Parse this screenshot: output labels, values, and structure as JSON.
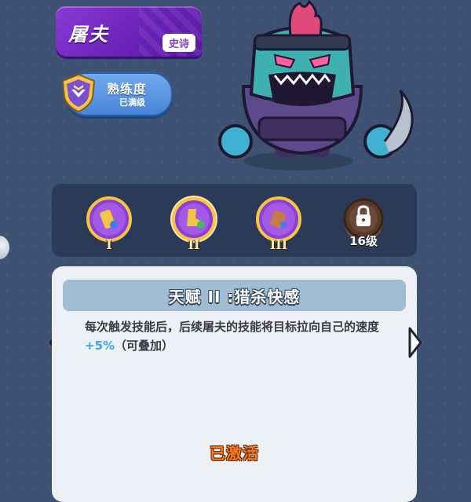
{
  "hero": {
    "name": "屠夫",
    "rarity": "史诗"
  },
  "proficiency": {
    "label": "熟练度",
    "status": "已满级"
  },
  "talents": [
    {
      "numeral": "I",
      "state": "unlocked",
      "color": "#8a3fd6"
    },
    {
      "numeral": "II",
      "state": "selected",
      "color": "#8a3fd6"
    },
    {
      "numeral": "III",
      "state": "unlocked",
      "color": "#8a3fd6"
    },
    {
      "level_label": "16级",
      "state": "locked",
      "color": "#5a3b2a"
    }
  ],
  "detail": {
    "title": "天赋 II :猎杀快感",
    "desc_part1": "每次触发技能后，后续屠夫的技能将目标拉向自己的速度",
    "desc_highlight": "+5%",
    "desc_part2": "（可叠加）",
    "status": "已激活"
  },
  "colors": {
    "background": "#3e5374",
    "accent_purple": "#7a2fc8",
    "highlight": "#36a8f0",
    "status_orange": "#ff7a1f"
  }
}
